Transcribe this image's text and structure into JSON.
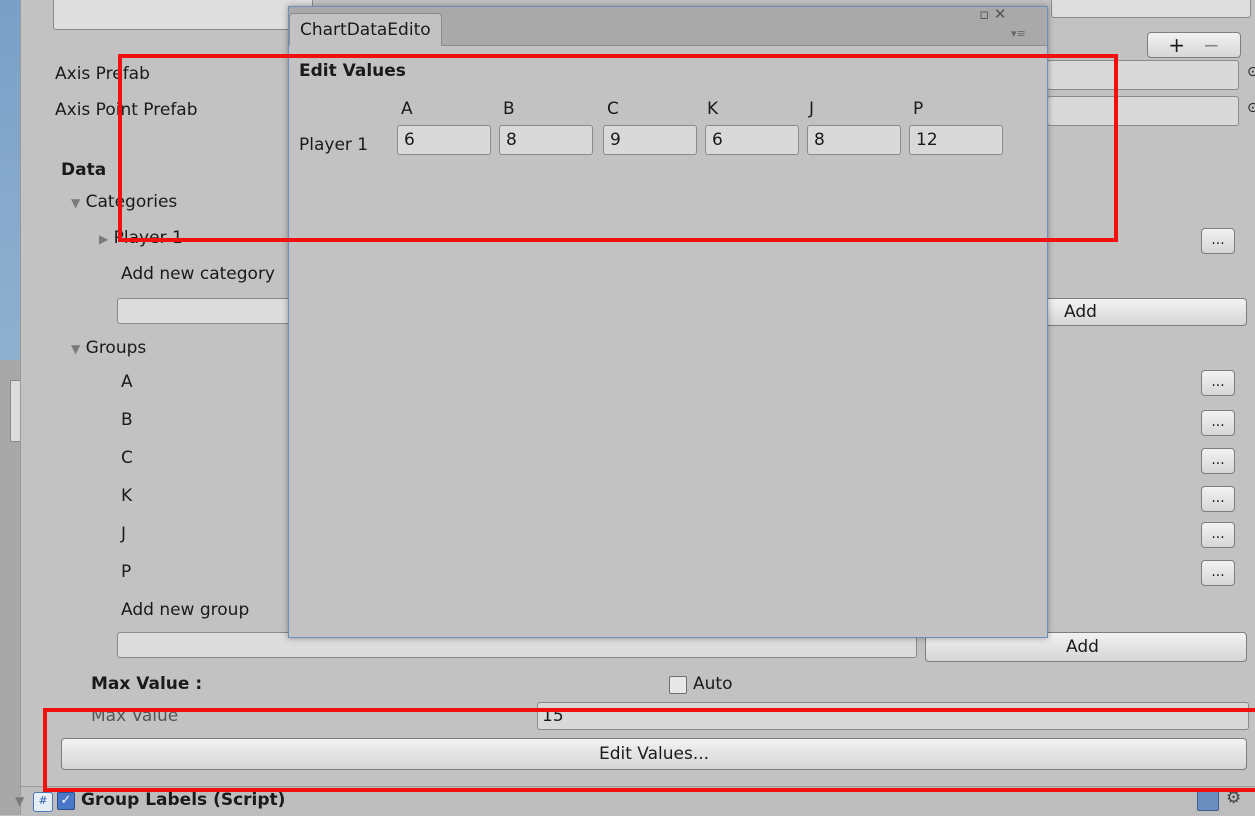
{
  "inspector": {
    "axis_prefab_label": "Axis Prefab",
    "axis_point_prefab_label": "Axis Point Prefab",
    "data_heading": "Data",
    "categories_label": "Categories",
    "category_item": "Player 1",
    "add_category_label": "Add new category",
    "add_button": "Add",
    "groups_label": "Groups",
    "groups": [
      "A",
      "B",
      "C",
      "K",
      "J",
      "P"
    ],
    "add_group_label": "Add new group",
    "max_value_heading": "Max Value :",
    "auto_label": "Auto",
    "max_value_label": "Max Value",
    "max_value": "15",
    "edit_values_button": "Edit Values...",
    "component_title": "Group Labels (Script)",
    "plus": "+",
    "minus": "−",
    "dots": "..."
  },
  "editor": {
    "tab_title": "ChartDataEdito",
    "heading": "Edit Values",
    "columns": [
      "A",
      "B",
      "C",
      "K",
      "J",
      "P"
    ],
    "rows": [
      {
        "label": "Player 1",
        "values": [
          "6",
          "8",
          "9",
          "6",
          "8",
          "12"
        ]
      }
    ],
    "window_icons": "▫ ✕",
    "menu_icon": "▾≡"
  }
}
